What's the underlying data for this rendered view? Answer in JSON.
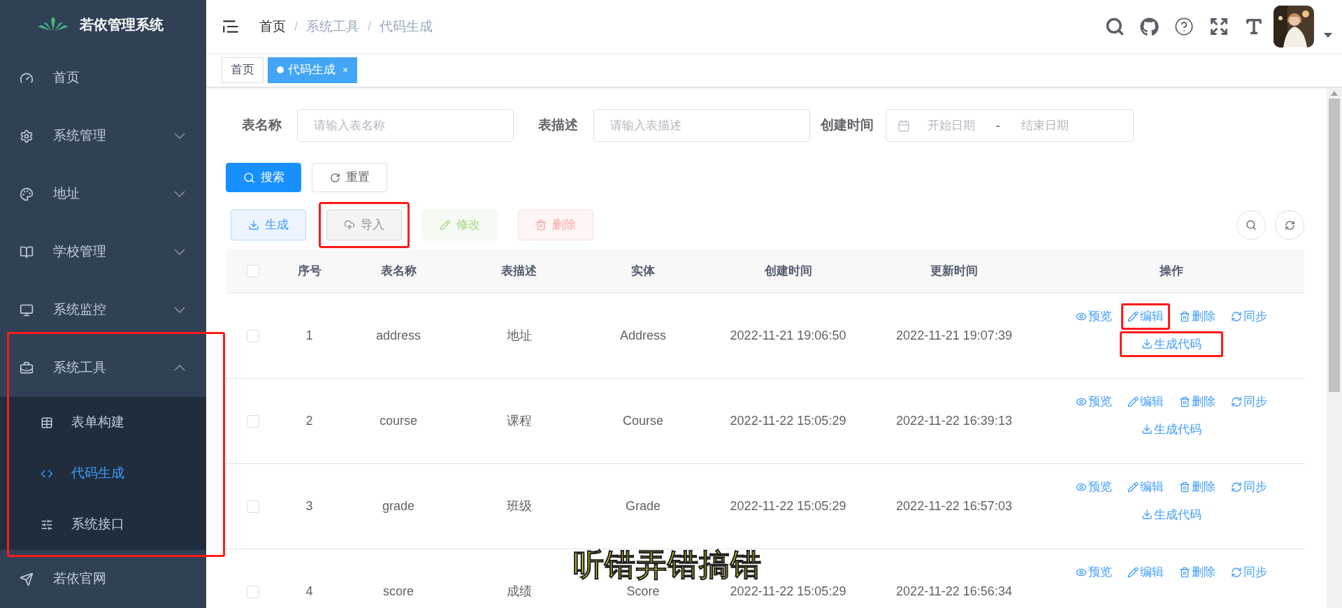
{
  "sidebar": {
    "title": "若依管理系统",
    "items": [
      {
        "label": "首页"
      },
      {
        "label": "系统管理",
        "expanded": false
      },
      {
        "label": "地址",
        "expanded": false
      },
      {
        "label": "学校管理",
        "expanded": false
      },
      {
        "label": "系统监控",
        "expanded": false
      },
      {
        "label": "系统工具",
        "expanded": true,
        "highlighted": true,
        "children": [
          {
            "label": "表单构建",
            "selected": false
          },
          {
            "label": "代码生成",
            "selected": true
          },
          {
            "label": "系统接口",
            "selected": false
          }
        ]
      },
      {
        "label": "若依官网"
      }
    ]
  },
  "breadcrumb": {
    "separator": "/",
    "items": [
      "首页",
      "系统工具",
      "代码生成"
    ]
  },
  "tags": [
    {
      "label": "首页",
      "selected": false
    },
    {
      "label": "代码生成",
      "selected": true,
      "close": "×"
    }
  ],
  "search_form": {
    "fields": [
      {
        "label": "表名称",
        "placeholder": "请输入表名称"
      },
      {
        "label": "表描述",
        "placeholder": "请输入表描述"
      }
    ],
    "date_range": {
      "label": "创建时间",
      "start_placeholder": "开始日期",
      "separator": "-",
      "end_placeholder": "结束日期"
    },
    "buttons": [
      {
        "label": "搜索",
        "kind": "primary"
      },
      {
        "label": "重置",
        "kind": "default"
      }
    ]
  },
  "toolbar": [
    {
      "label": "生成",
      "kind": "primary",
      "disabled": false,
      "highlighted": false
    },
    {
      "label": "导入",
      "kind": "info",
      "disabled": false,
      "highlighted": true
    },
    {
      "label": "修改",
      "kind": "success",
      "disabled": true,
      "highlighted": false
    },
    {
      "label": "删除",
      "kind": "danger",
      "disabled": true,
      "highlighted": false
    }
  ],
  "table": {
    "header_checked": false,
    "columns": [
      "序号",
      "表名称",
      "表描述",
      "实体",
      "创建时间",
      "更新时间",
      "操作"
    ],
    "rows": [
      {
        "checked": false,
        "cells": [
          "1",
          "address",
          "地址",
          "Address",
          "2022-11-21 19:06:50",
          "2022-11-21 19:07:39"
        ],
        "actions": [
          {
            "label": "预览",
            "highlighted": false
          },
          {
            "label": "编辑",
            "highlighted": true
          },
          {
            "label": "删除",
            "highlighted": false
          },
          {
            "label": "同步",
            "highlighted": false
          },
          {
            "label": "生成代码",
            "highlighted": true
          }
        ]
      },
      {
        "checked": false,
        "cells": [
          "2",
          "course",
          "课程",
          "Course",
          "2022-11-22 15:05:29",
          "2022-11-22 16:39:13"
        ],
        "actions": [
          {
            "label": "预览",
            "highlighted": false
          },
          {
            "label": "编辑",
            "highlighted": false
          },
          {
            "label": "删除",
            "highlighted": false
          },
          {
            "label": "同步",
            "highlighted": false
          },
          {
            "label": "生成代码",
            "highlighted": false
          }
        ]
      },
      {
        "checked": false,
        "cells": [
          "3",
          "grade",
          "班级",
          "Grade",
          "2022-11-22 15:05:29",
          "2022-11-22 16:57:03"
        ],
        "actions": [
          {
            "label": "预览",
            "highlighted": false
          },
          {
            "label": "编辑",
            "highlighted": false
          },
          {
            "label": "删除",
            "highlighted": false
          },
          {
            "label": "同步",
            "highlighted": false
          },
          {
            "label": "生成代码",
            "highlighted": false
          }
        ]
      },
      {
        "checked": false,
        "cells": [
          "4",
          "score",
          "成绩",
          "Score",
          "2022-11-22 15:05:29",
          "2022-11-22 16:56:34"
        ],
        "actions": [
          {
            "label": "预览",
            "highlighted": false
          },
          {
            "label": "编辑",
            "highlighted": false
          },
          {
            "label": "删除",
            "highlighted": false
          },
          {
            "label": "同步",
            "highlighted": false
          }
        ]
      }
    ]
  },
  "caption": "听错弄错搞错"
}
